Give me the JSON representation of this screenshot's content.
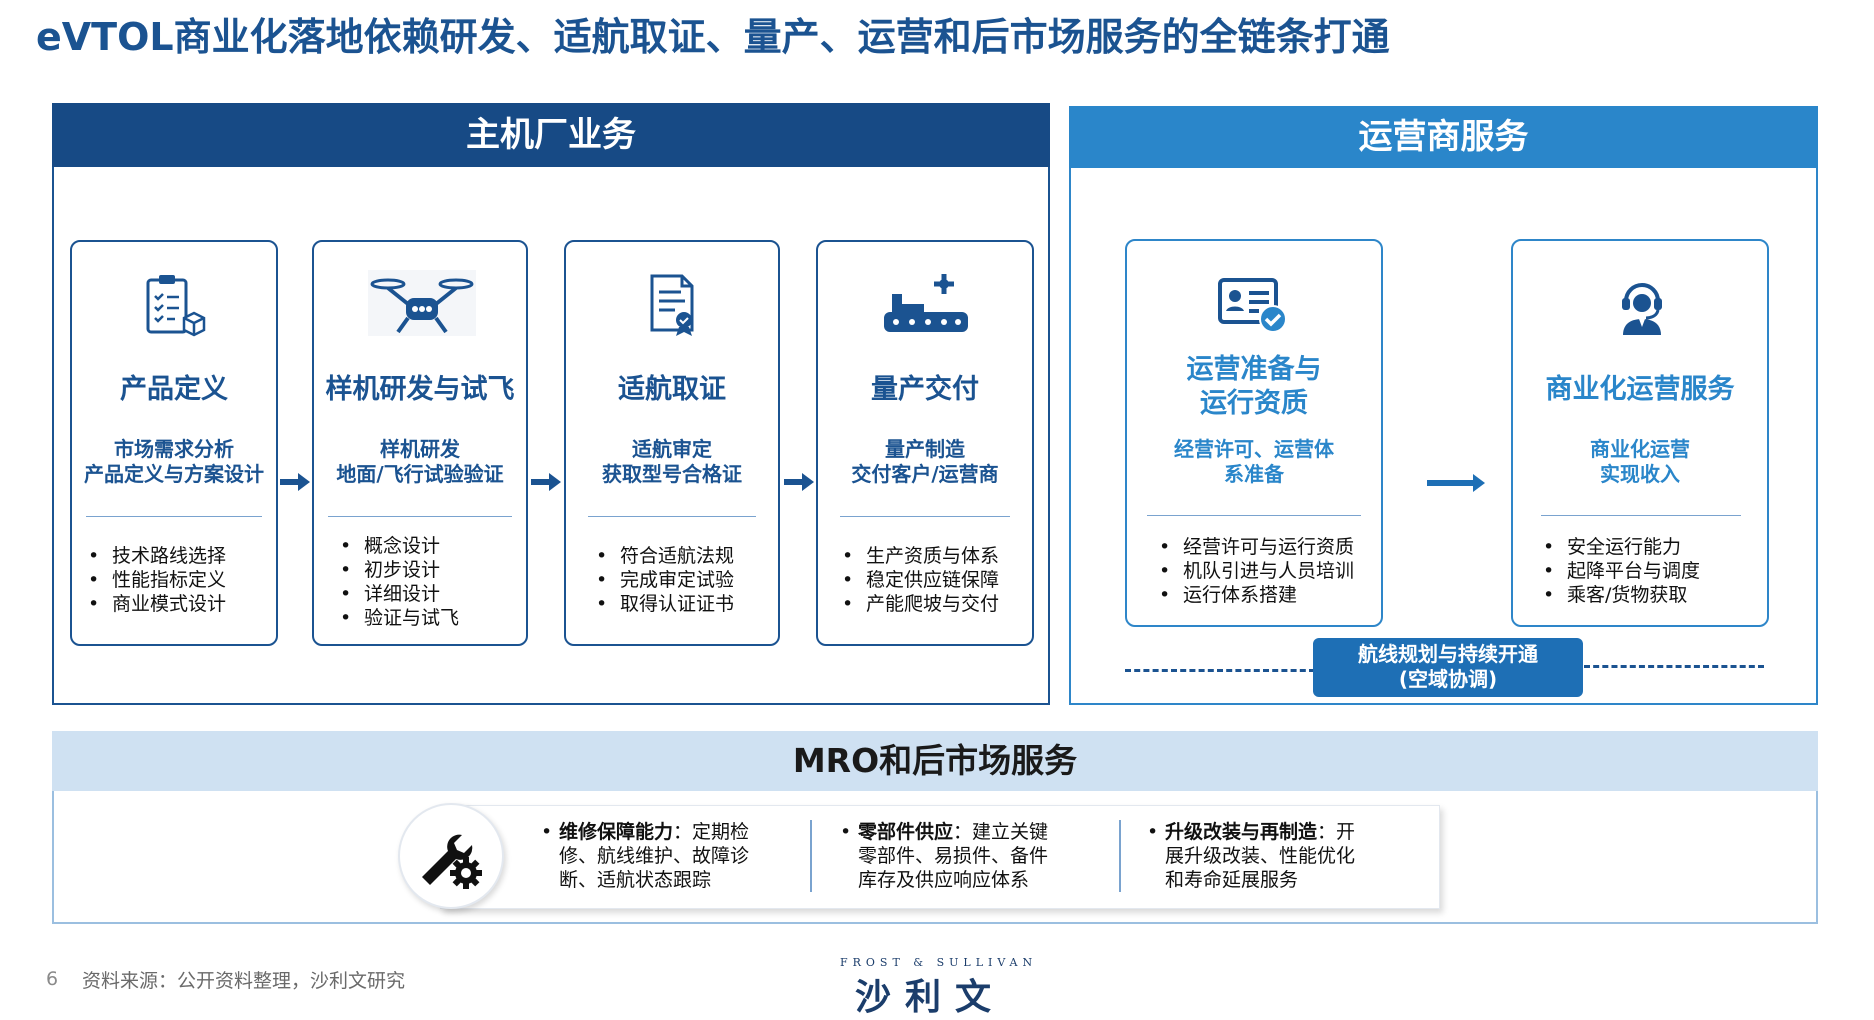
{
  "title": "eVTOL商业化落地依赖研发、适航取证、量产、运营和后市场服务的全链条打通",
  "oem": {
    "header": "主机厂业务",
    "cards": [
      {
        "title": "产品定义",
        "sub": [
          "市场需求分析",
          "产品定义与方案设计"
        ],
        "bullets": [
          "技术路线选择",
          "性能指标定义",
          "商业模式设计"
        ],
        "icon": "clipboard-icon"
      },
      {
        "title": "样机研发与试飞",
        "sub": [
          "样机研发",
          "地面/飞行试验验证"
        ],
        "bullets": [
          "概念设计",
          "初步设计",
          "详细设计",
          "验证与试飞"
        ],
        "icon": "drone-icon"
      },
      {
        "title": "适航取证",
        "sub": [
          "适航审定",
          "获取型号合格证"
        ],
        "bullets": [
          "符合适航法规",
          "完成审定试验",
          "取得认证证书"
        ],
        "icon": "certificate-icon"
      },
      {
        "title": "量产交付",
        "sub": [
          "量产制造",
          "交付客户/运营商"
        ],
        "bullets": [
          "生产资质与体系",
          "稳定供应链保障",
          "产能爬坡与交付"
        ],
        "icon": "conveyor-icon"
      }
    ]
  },
  "operator": {
    "header": "运营商服务",
    "cards": [
      {
        "title": [
          "运营准备与",
          "运行资质"
        ],
        "sub": [
          "经营许可、运营体",
          "系准备"
        ],
        "bullets": [
          "经营许可与运行资质",
          "机队引进与人员培训",
          "运行体系搭建"
        ],
        "icon": "license-icon"
      },
      {
        "title": [
          "商业化运营服务"
        ],
        "sub": [
          "商业化运营",
          "实现收入"
        ],
        "bullets": [
          "安全运行能力",
          "起降平台与调度",
          "乘客/货物获取"
        ],
        "icon": "headset-operator-icon"
      }
    ],
    "route_badge": [
      "航线规划与持续开通",
      "(空域协调)"
    ]
  },
  "mro": {
    "header": "MRO和后市场服务",
    "icon": "wrench-gear-icon",
    "items": [
      {
        "lead": "维修保障能力",
        "sep": "：",
        "lines": [
          "定期检",
          "修、航线维护、故障诊",
          "断、适航状态跟踪"
        ]
      },
      {
        "lead": "零部件供应",
        "sep": "：",
        "lines": [
          "建立关键",
          "零部件、易损件、备件",
          "库存及供应响应体系"
        ]
      },
      {
        "lead": "升级改装与再制造",
        "sep": "：",
        "lines": [
          "开",
          "展升级改装、性能优化",
          "和寿命延展服务"
        ]
      }
    ]
  },
  "footer": {
    "page_number": "6",
    "source": "资料来源：公开资料整理，沙利文研究",
    "logo_en": "FROST & SULLIVAN",
    "logo_cn": "沙利文"
  },
  "colors": {
    "primary": "#1b5391",
    "secondary": "#2a86ca",
    "mro_header": "#cfe1f2"
  }
}
